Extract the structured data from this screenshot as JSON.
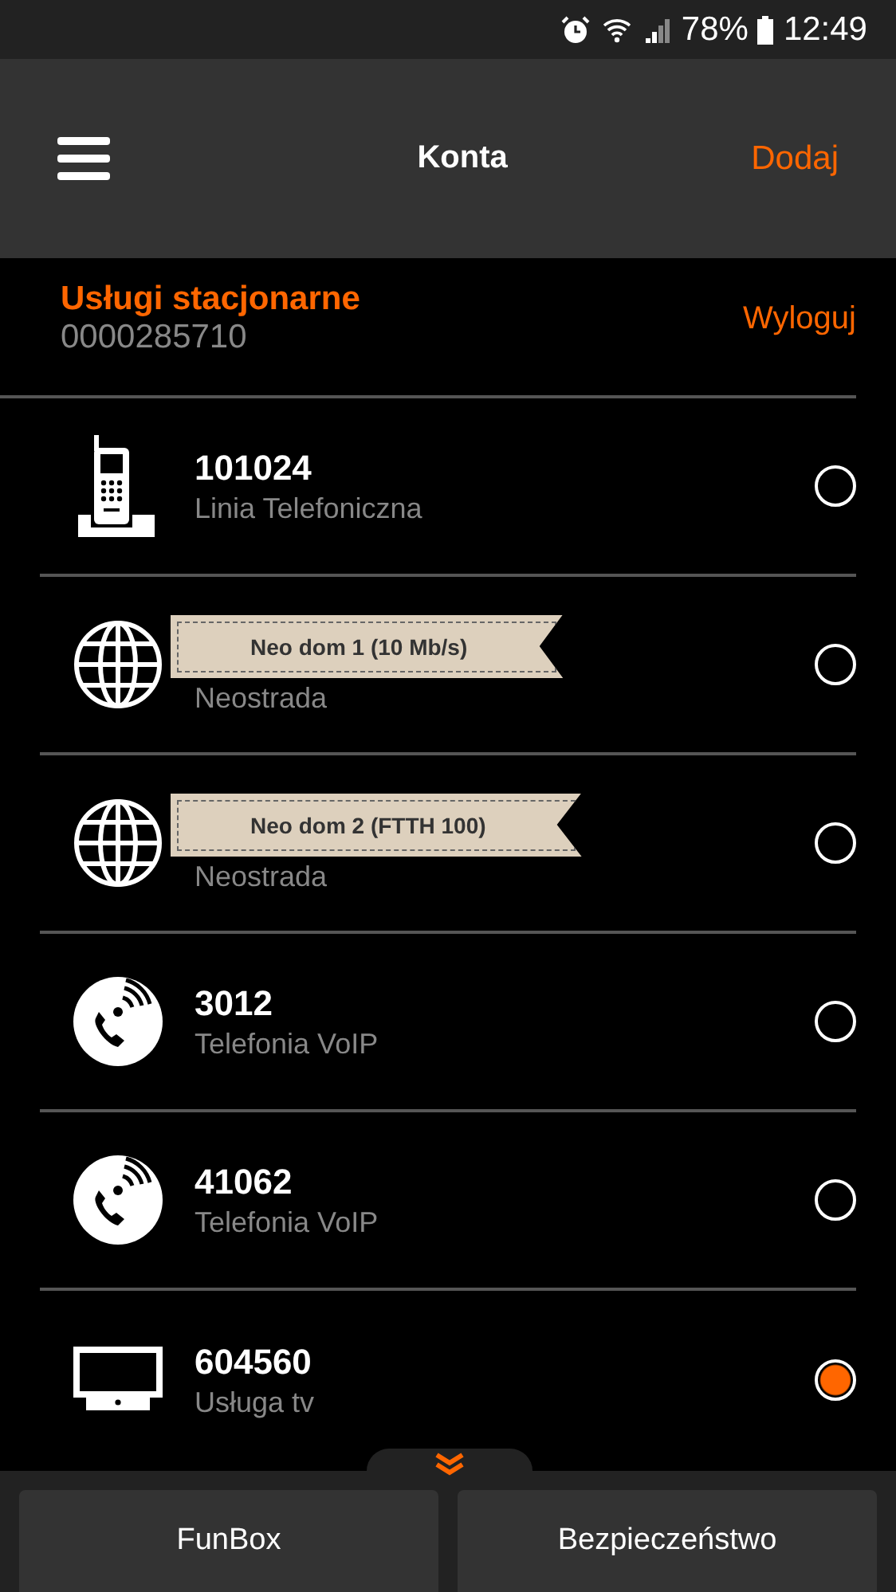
{
  "status_bar": {
    "battery": "78%",
    "time": "12:49"
  },
  "header": {
    "title": "Konta",
    "action": "Dodaj"
  },
  "account": {
    "title": "Usługi stacjonarne",
    "number": "0000285710",
    "logout": "Wyloguj"
  },
  "services": [
    {
      "kind": "phone",
      "number": "101024",
      "type": "Linia Telefoniczna",
      "selected": false
    },
    {
      "kind": "globe",
      "badge": "Neo dom 1 (10 Mb/s)",
      "type": "Neostrada",
      "selected": false
    },
    {
      "kind": "globe",
      "badge": "Neo dom 2 (FTTH 100)",
      "type": "Neostrada",
      "selected": false
    },
    {
      "kind": "voip",
      "number": "3012",
      "type": "Telefonia VoIP",
      "selected": false
    },
    {
      "kind": "voip",
      "number": "41062",
      "type": "Telefonia VoIP",
      "selected": false
    },
    {
      "kind": "tv",
      "number": "604560",
      "type": "Usługa tv",
      "selected": true
    }
  ],
  "bottom_buttons": [
    "FunBox",
    "Bezpieczeństwo"
  ]
}
